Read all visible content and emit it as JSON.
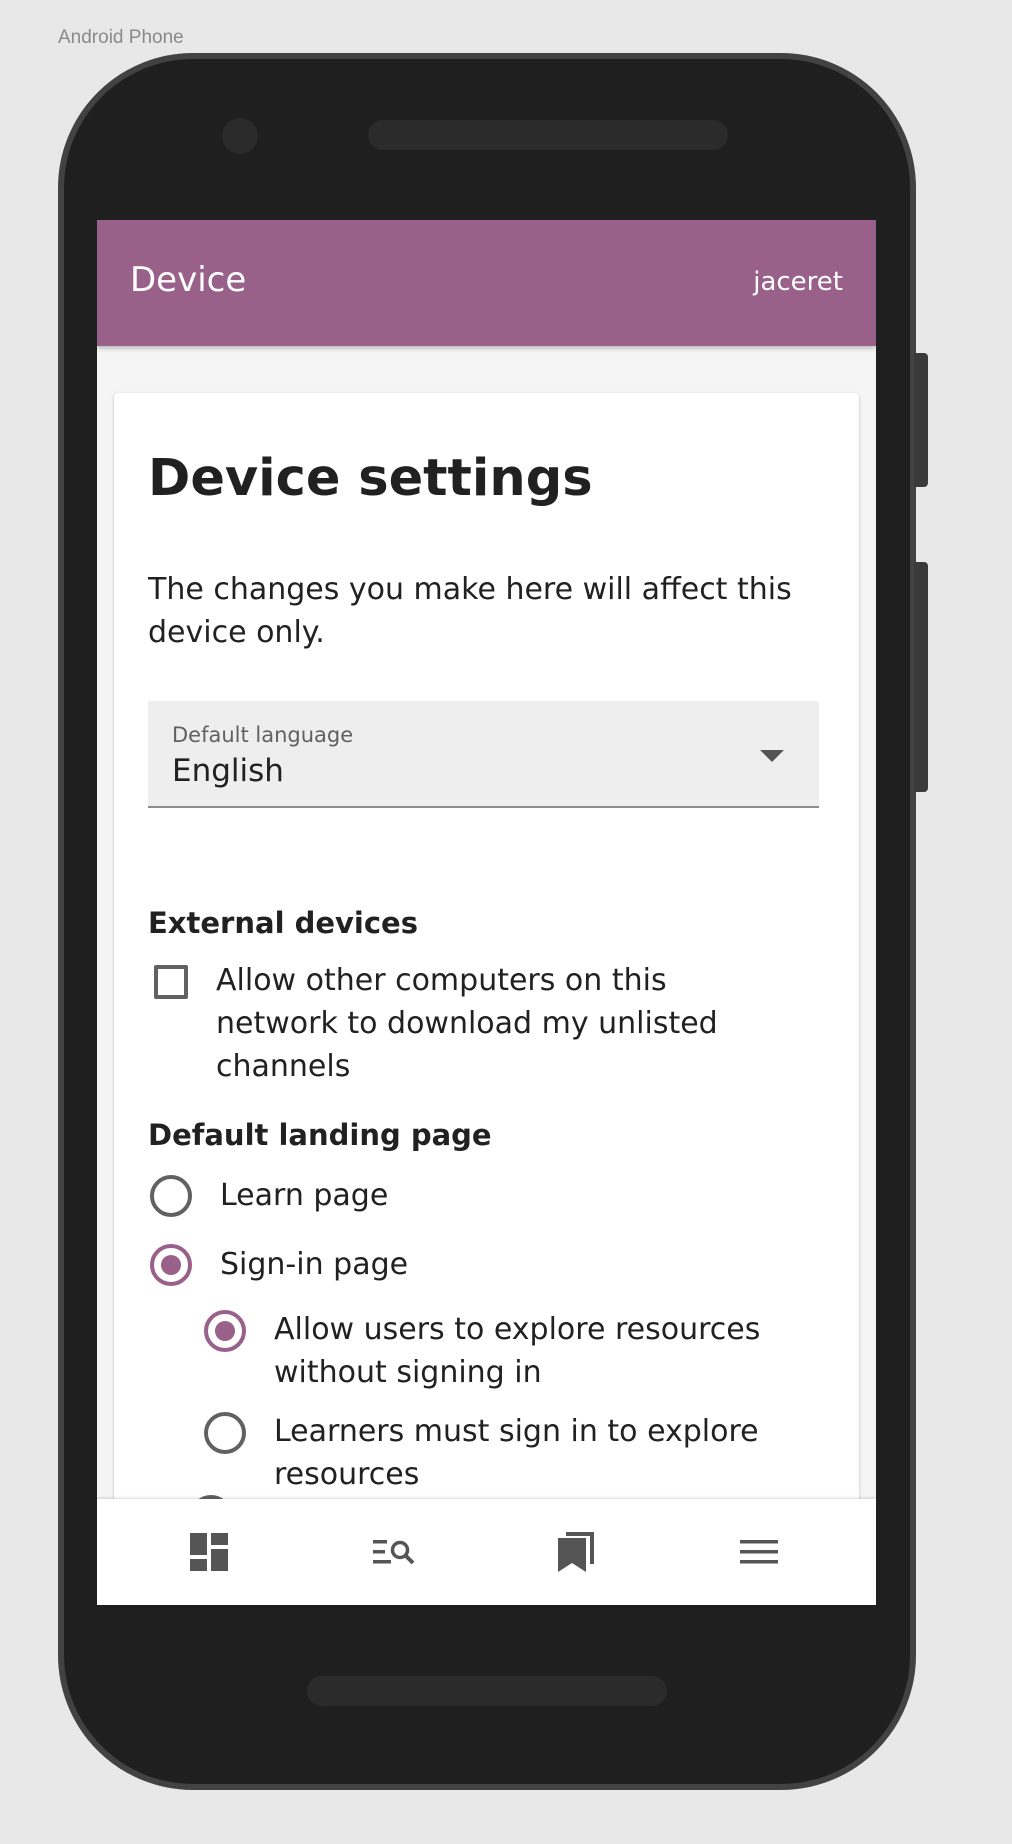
{
  "frame_label": "Android Phone",
  "appbar": {
    "title": "Device",
    "user": "jaceret"
  },
  "page": {
    "title": "Device settings",
    "description": "The changes you make here will affect this device only."
  },
  "language_select": {
    "label": "Default language",
    "value": "English"
  },
  "external_devices": {
    "heading": "External devices",
    "checkbox_label": "Allow other computers on this network to download my unlisted channels",
    "checked": false
  },
  "landing_page": {
    "heading": "Default landing page",
    "options": [
      {
        "label": "Learn page",
        "selected": false
      },
      {
        "label": "Sign-in page",
        "selected": true
      }
    ],
    "sub_options": [
      {
        "label": "Allow users to explore resources without signing in",
        "selected": true
      },
      {
        "label": "Learners must sign in to explore resources",
        "selected": false
      }
    ]
  },
  "bottom_nav": {
    "items": [
      {
        "icon": "dashboard-icon"
      },
      {
        "icon": "library-search-icon"
      },
      {
        "icon": "bookmarks-icon"
      },
      {
        "icon": "menu-icon"
      }
    ]
  },
  "colors": {
    "accent": "#996189",
    "phone_body": "#1f1f1f",
    "phone_bezel": "#424242",
    "background": "#e8e8e8"
  }
}
